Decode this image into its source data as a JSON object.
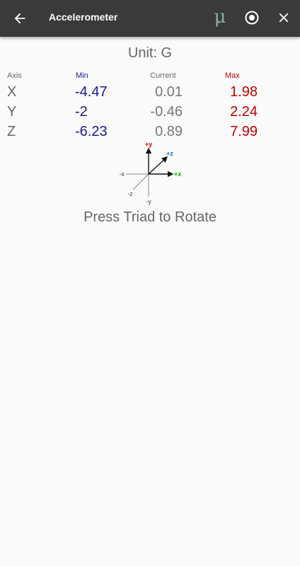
{
  "appbar": {
    "title": "Accelerometer",
    "mu_label": "μ",
    "back_icon": "arrow-back-icon",
    "target_icon": "record-target-icon",
    "close_icon": "close-icon"
  },
  "unit_label": "Unit: G",
  "table": {
    "headers": {
      "axis": "Axis",
      "min": "Min",
      "current": "Current",
      "max": "Max"
    },
    "rows": [
      {
        "axis": "X",
        "min": "-4.47",
        "current": "0.01",
        "max": "1.98"
      },
      {
        "axis": "Y",
        "min": "-2",
        "current": "-0.46",
        "max": "2.24"
      },
      {
        "axis": "Z",
        "min": "-6.23",
        "current": "0.89",
        "max": "7.99"
      }
    ]
  },
  "triad": {
    "labels": {
      "px": "+x",
      "nx": "-x",
      "py": "+y",
      "ny": "-y",
      "pz": "+z",
      "nz": "-z"
    },
    "colors": {
      "x": "#00aa00",
      "y": "#cc0000",
      "z": "#0077cc",
      "neg": "#444444"
    }
  },
  "prompt": "Press Triad to Rotate"
}
